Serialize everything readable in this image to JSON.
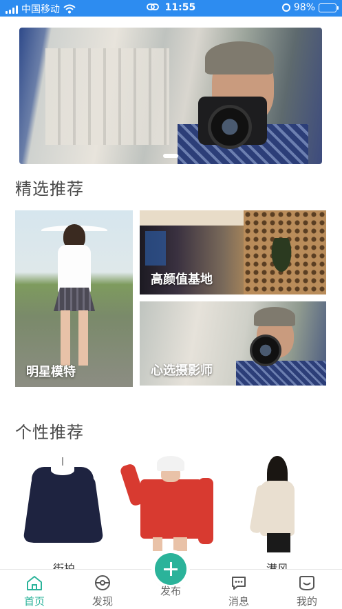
{
  "status_bar": {
    "carrier": "中国移动",
    "time": "11:55",
    "battery": "98%",
    "battery_level": 0.98
  },
  "banner": {
    "active_index": 0
  },
  "featured": {
    "title": "精选推荐",
    "tiles": [
      {
        "label": "明星模特"
      },
      {
        "label": "高颜值基地"
      },
      {
        "label": "心选摄影师"
      }
    ]
  },
  "personal": {
    "title": "个性推荐",
    "items": [
      {
        "label": "街拍"
      },
      {
        "label": ""
      },
      {
        "label": "港风"
      }
    ]
  },
  "tabbar": {
    "active": "home",
    "items": [
      {
        "key": "home",
        "label": "首页",
        "icon": "home-icon"
      },
      {
        "key": "discover",
        "label": "发现",
        "icon": "compass-icon"
      },
      {
        "key": "publish",
        "label": "发布",
        "icon": "plus-icon"
      },
      {
        "key": "messages",
        "label": "消息",
        "icon": "chat-icon"
      },
      {
        "key": "mine",
        "label": "我的",
        "icon": "smile-icon"
      }
    ],
    "accent_color": "#2bb39a"
  },
  "colors": {
    "status_bar": "#2d8cf0",
    "accent": "#2bb39a"
  }
}
